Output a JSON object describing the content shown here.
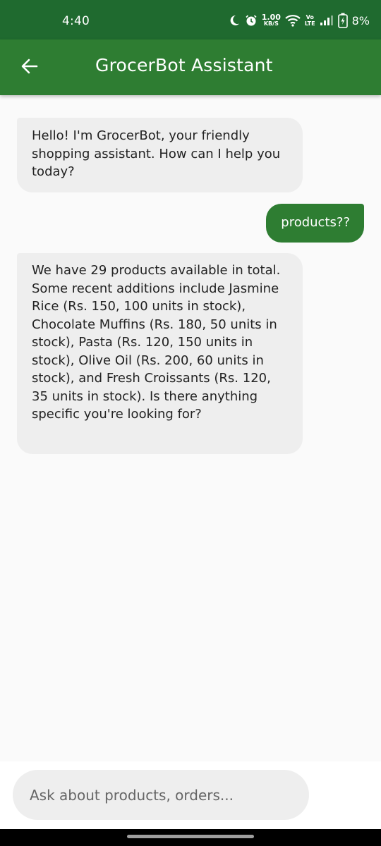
{
  "status_bar": {
    "time": "4:40",
    "net_speed_value": "1.00",
    "net_speed_unit": "KB/S",
    "volte_top": "Vo",
    "volte_bottom": "LTE",
    "battery": "8%",
    "icons": [
      "moon-icon",
      "alarm-icon",
      "wifi-icon",
      "signal-icon",
      "battery-charging-icon"
    ]
  },
  "app_bar": {
    "title": "GrocerBot Assistant",
    "back_icon": "arrow-left-icon",
    "color": "#2e7d32"
  },
  "messages": [
    {
      "sender": "bot",
      "text": "Hello! I'm GrocerBot, your friendly shopping assistant. How can I help you today?"
    },
    {
      "sender": "user",
      "text": "products??"
    },
    {
      "sender": "bot",
      "text": "We have 29 products available in total.  Some recent additions include Jasmine Rice (Rs. 150, 100 units in stock), Chocolate Muffins (Rs. 180, 50 units in stock), Pasta (Rs. 120, 150 units in stock), Olive Oil (Rs. 200, 60 units in stock), and Fresh Croissants (Rs. 120, 35 units in stock).  Is there anything specific you're looking for?"
    }
  ],
  "composer": {
    "value": "",
    "placeholder": "Ask about products, orders..."
  },
  "colors": {
    "status_bar": "#1f6a2f",
    "accent": "#2e7d32",
    "bot_bubble": "#eeeeee",
    "background": "#fafafa"
  }
}
